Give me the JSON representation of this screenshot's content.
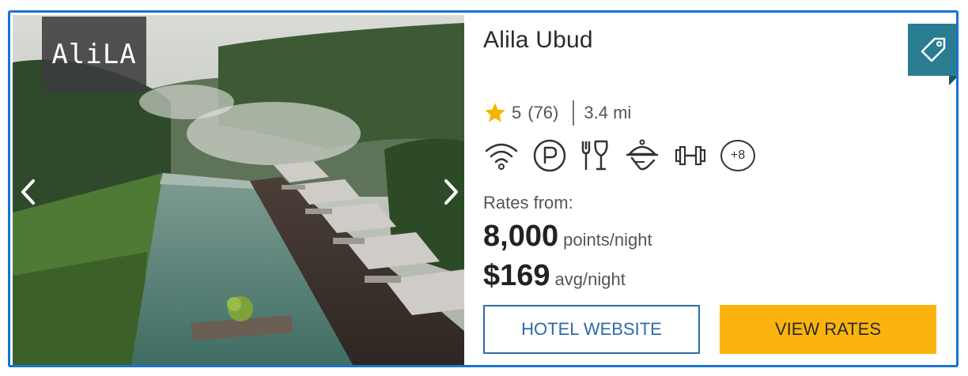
{
  "hotel": {
    "logo_text": "AliLA",
    "name": "Alila Ubud",
    "rating": "5",
    "review_count": "(76)",
    "distance": "3.4 mi"
  },
  "amenities": {
    "icons": [
      "wifi-icon",
      "parking-icon",
      "dining-icon",
      "room-service-icon",
      "fitness-icon"
    ],
    "more_label": "+8"
  },
  "rates": {
    "label": "Rates from:",
    "points_value": "8,000",
    "points_unit": "points/night",
    "cash_value": "$169",
    "cash_unit": "avg/night"
  },
  "buttons": {
    "website_label": "HOTEL WEBSITE",
    "rates_label": "VIEW RATES"
  },
  "colors": {
    "border": "#1a73d0",
    "tag": "#2a7d91",
    "star": "#f5b400",
    "primary_button": "#fbb40e",
    "secondary_button_text": "#2e6ba6"
  }
}
